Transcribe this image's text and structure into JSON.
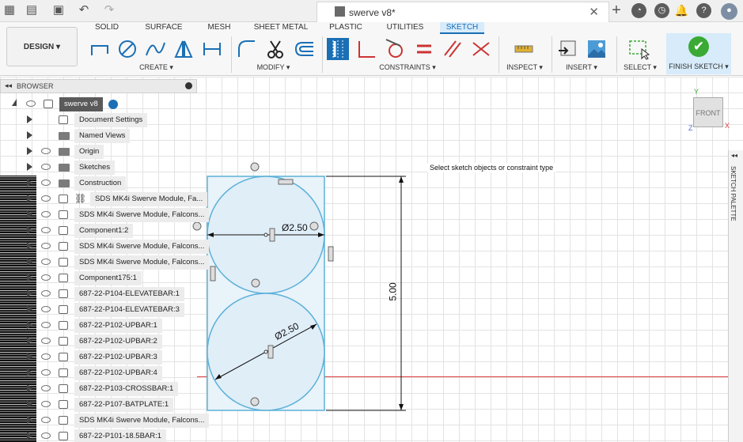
{
  "titlebar": {
    "document_title": "swerve v8*"
  },
  "ribbon": {
    "tabs": [
      {
        "label": "SOLID"
      },
      {
        "label": "SURFACE"
      },
      {
        "label": "MESH"
      },
      {
        "label": "SHEET METAL"
      },
      {
        "label": "PLASTIC"
      },
      {
        "label": "UTILITIES"
      },
      {
        "label": "SKETCH",
        "active": true
      }
    ],
    "design_label": "DESIGN ▾",
    "groups": {
      "create": "CREATE ▾",
      "modify": "MODIFY ▾",
      "constraints": "CONSTRAINTS ▾",
      "inspect": "INSPECT ▾",
      "insert": "INSERT ▾",
      "select": "SELECT ▾"
    },
    "finish_sketch": "FINISH SKETCH ▾"
  },
  "browser": {
    "title": "BROWSER",
    "root": "swerve v8",
    "items": [
      "Document Settings",
      "Named Views",
      "Origin",
      "Sketches",
      "Construction",
      "SDS MK4i Swerve Module, Fa...",
      "SDS MK4i Swerve Module, Falcons...",
      "Component1:2",
      "SDS MK4i Swerve Module, Falcons...",
      "SDS MK4i Swerve Module, Falcons...",
      "Component175:1",
      "687-22-P104-ELEVATEBAR:1",
      "687-22-P104-ELEVATEBAR:3",
      "687-22-P102-UPBAR:1",
      "687-22-P102-UPBAR:2",
      "687-22-P102-UPBAR:3",
      "687-22-P102-UPBAR:4",
      "687-22-P103-CROSSBAR:1",
      "687-22-P107-BATPLATE:1",
      "SDS MK4i Swerve Module, Falcons...",
      "687-22-P101-18.5BAR:1"
    ]
  },
  "canvas": {
    "tooltip": "Select sketch objects or constraint type",
    "dimension_top": "Ø2.50",
    "dimension_bottom": "Ø2.50",
    "dimension_height": "5.00",
    "viewcube_label": "FRONT",
    "palette_label": "SKETCH PALETTE"
  },
  "colors": {
    "accent": "#1a6fb5",
    "sketch_line": "#5bb0d8",
    "sketch_fill": "#e8f3fa",
    "finish_green": "#3aaa35",
    "axis_red": "#e04040"
  }
}
